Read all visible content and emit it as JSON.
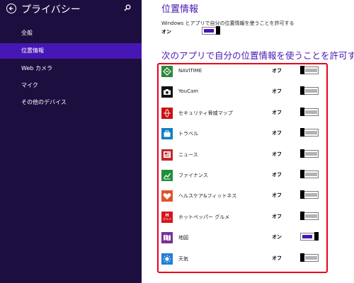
{
  "sidebar": {
    "title": "プライバシー",
    "items": [
      {
        "label": "全般",
        "selected": false
      },
      {
        "label": "位置情報",
        "selected": true
      },
      {
        "label": "Web カメラ",
        "selected": false
      },
      {
        "label": "マイク",
        "selected": false
      },
      {
        "label": "その他のデバイス",
        "selected": false
      }
    ]
  },
  "main": {
    "title": "位置情報",
    "description": "Windows とアプリで自分の位置情報を使うことを許可する",
    "state": "オン",
    "enabled": true,
    "section_title": "次のアプリで自分の位置情報を使うことを許可する"
  },
  "apps": [
    {
      "name": "NAVITIME",
      "state": "オフ",
      "on": false,
      "icon": "navitime-icon",
      "color": "#2c8a3a"
    },
    {
      "name": "YouCam",
      "state": "オフ",
      "on": false,
      "icon": "camera-icon",
      "color": "#111111"
    },
    {
      "name": "セキュリティ脅威マップ",
      "state": "オフ",
      "on": false,
      "icon": "globe-icon",
      "color": "#cc1111"
    },
    {
      "name": "トラベル",
      "state": "オフ",
      "on": false,
      "icon": "suitcase-icon",
      "color": "#0f7fc6"
    },
    {
      "name": "ニュース",
      "state": "オフ",
      "on": false,
      "icon": "newspaper-icon",
      "color": "#c1272d"
    },
    {
      "name": "ファイナンス",
      "state": "オフ",
      "on": false,
      "icon": "chart-icon",
      "color": "#1f8f3a"
    },
    {
      "name": "ヘルスケア&フィットネス",
      "state": "オフ",
      "on": false,
      "icon": "heart-icon",
      "color": "#e2522b"
    },
    {
      "name": "ホットペッパー グルメ",
      "state": "オフ",
      "on": false,
      "icon": "hotpepper-icon",
      "color": "#d7141a",
      "icon_text": "グルメ"
    },
    {
      "name": "地図",
      "state": "オン",
      "on": true,
      "icon": "map-icon",
      "color": "#7a2f9a"
    },
    {
      "name": "天気",
      "state": "オフ",
      "on": false,
      "icon": "sun-icon",
      "color": "#1f7fd6"
    }
  ],
  "colors": {
    "sidebar_bg": "#1c0f40",
    "accent": "#4617b4",
    "frame": "#e8001c"
  }
}
